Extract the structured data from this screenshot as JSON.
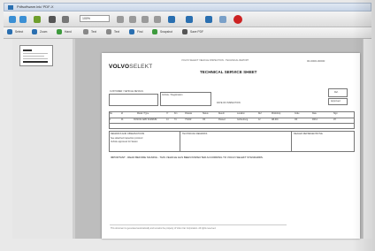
{
  "window": {
    "title": "Pdfsoftware.lnk/ PDF-X"
  },
  "toolbar": {
    "zoom_value": "100%"
  },
  "toolbar2": {
    "items": [
      "Select",
      "Zoom",
      "Hand",
      "Text",
      "Text",
      "Find",
      "Snapshot",
      "Save PDF"
    ]
  },
  "document": {
    "brand_bold": "VOLVO",
    "brand_rest": "SELEKT",
    "heading": "TECHNICAL SERVICE SHEET",
    "sub_header": "VOLVO SELEKT VEHICLE INSPECTION - TECHNICAL REPORT",
    "doc_number": "00-0000-00000",
    "customer_label": "CUSTOMER / VEHICLE DETAILS",
    "vehicle_label": "Vehicle / Registration",
    "date_label": "DATE OF INSPECTION",
    "box_small_1": "Ref.",
    "box_small_2": "Approved",
    "table_headers": [
      "No.",
      "Id",
      "Model / Type",
      "Yr",
      "Km",
      "Chassis",
      "Status",
      "Result",
      "Location",
      "Ref",
      "Workshop",
      "Code",
      "Date",
      "Sign"
    ],
    "table_row": [
      "1",
      "01",
      "XC60 D4 AWD SUMMUM",
      "14",
      "74",
      "YV1DZ",
      "OK",
      "Passed",
      "Gothenburg",
      "12",
      "AB-001",
      "OK",
      "03/14",
      "JH"
    ],
    "notes_label": "REMARKS AND OBSERVATIONS",
    "notes_sub": "See attached inspection protocol",
    "notes_sub2": "Vehicle approved for Selekt",
    "middle_label": "TECHNICIAN REMARKS",
    "right_label": "DEALER REPRESENTATIVE",
    "warning": "IMPORTANT - READ BEFORE SIGNING - THIS VEHICLE HAS BEEN INSPECTED ACCORDING TO VOLVO SELEKT STANDARDS.",
    "footer": "This document is generated automatically and remains the property of Volvo Car Corporation. All rights reserved."
  },
  "colors": {
    "accent": "#2a6fb0",
    "stop": "#cc2222",
    "viewer_bg": "#bdbdbd"
  }
}
